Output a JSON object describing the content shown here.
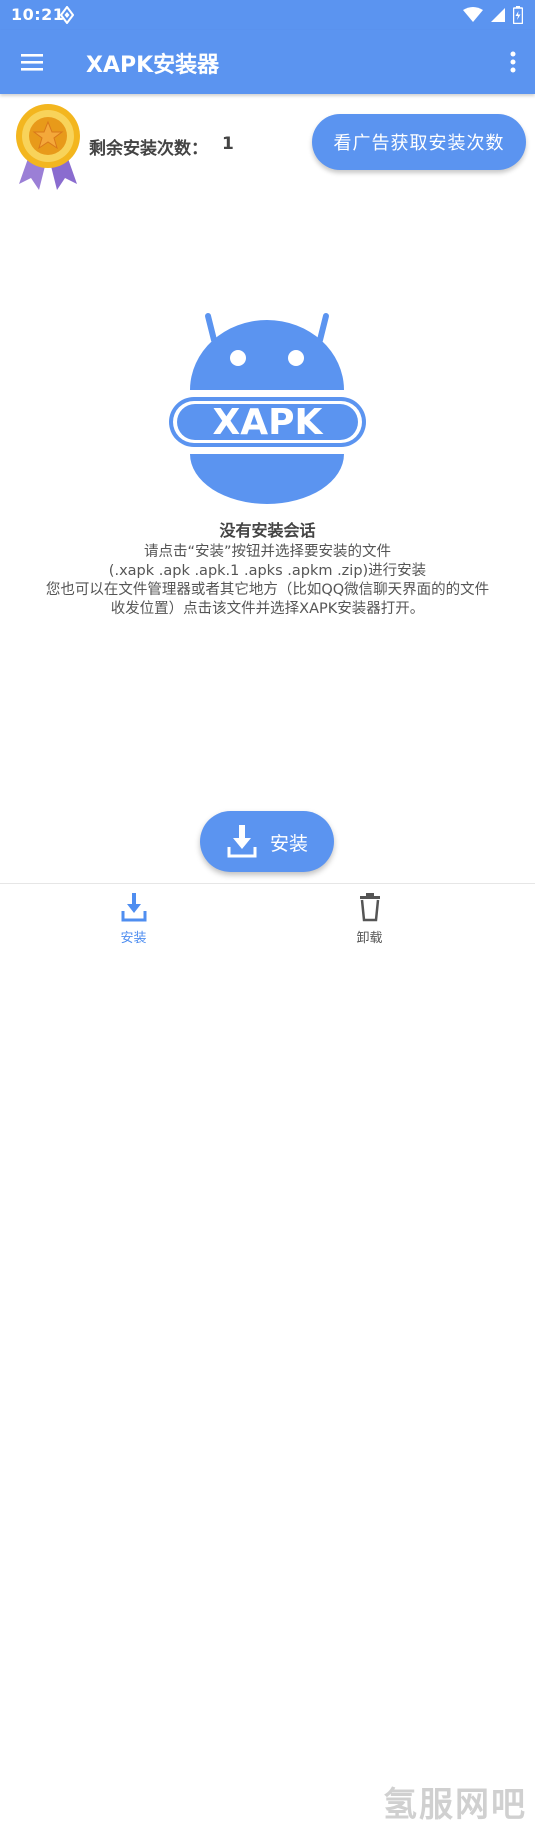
{
  "status_bar": {
    "time": "10:21"
  },
  "app_bar": {
    "title": "XAPK安装器"
  },
  "remaining": {
    "label": "剩余安装次数：",
    "count": "1"
  },
  "watch_ad_button": {
    "label": "看广告获取安装次数"
  },
  "logo": {
    "text": "XAPK"
  },
  "empty_state": {
    "title": "没有安装会话",
    "lines": [
      "请点击“安装”按钮并选择要安装的文件",
      "(.xapk .apk .apk.1 .apks .apkm .zip)进行安装",
      "您也可以在文件管理器或者其它地方（比如QQ微信聊天界面的的文件",
      "收发位置）点击该文件并选择XAPK安装器打开。"
    ]
  },
  "install_fab": {
    "label": "安装"
  },
  "bottom_nav": {
    "items": [
      {
        "label": "安装"
      },
      {
        "label": "卸载"
      }
    ]
  },
  "watermark": "氢服网吧",
  "colors": {
    "primary": "#5b94f0",
    "medal_gold": "#f3b61f",
    "ribbon": "#9b7fd6"
  },
  "icons": [
    "menu-icon",
    "more-vert-icon",
    "wifi-icon",
    "signal-icon",
    "battery-icon",
    "medal-icon",
    "download-icon",
    "trash-icon"
  ]
}
